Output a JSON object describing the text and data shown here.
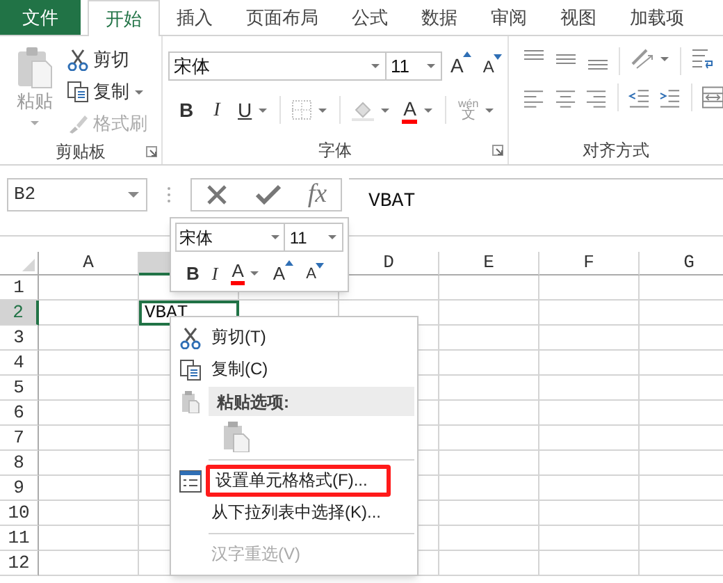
{
  "tabs": [
    {
      "label": "文件",
      "kind": "file",
      "selected": false
    },
    {
      "label": "开始",
      "kind": "tab",
      "selected": true
    },
    {
      "label": "插入",
      "kind": "tab",
      "selected": false
    },
    {
      "label": "页面布局",
      "kind": "tab",
      "selected": false
    },
    {
      "label": "公式",
      "kind": "tab",
      "selected": false
    },
    {
      "label": "数据",
      "kind": "tab",
      "selected": false
    },
    {
      "label": "审阅",
      "kind": "tab",
      "selected": false
    },
    {
      "label": "视图",
      "kind": "tab",
      "selected": false
    },
    {
      "label": "加载项",
      "kind": "tab",
      "selected": false
    }
  ],
  "ribbon": {
    "clipboard": {
      "paste": "粘贴",
      "cut": "剪切",
      "copy": "复制",
      "format_painter": "格式刷",
      "label": "剪贴板"
    },
    "font": {
      "font_name": "宋体",
      "font_size": "11",
      "grow": "A",
      "shrink": "A",
      "bold": "B",
      "italic": "I",
      "underline": "U",
      "font_color": "A",
      "phonetic_top": "wén",
      "phonetic_char": "文",
      "label": "字体"
    },
    "alignment": {
      "label": "对齐方式"
    }
  },
  "formula_bar": {
    "name_box": "B2",
    "function_label": "fx",
    "formula": "VBAT"
  },
  "grid": {
    "columns": [
      {
        "label": "A",
        "selected": false
      },
      {
        "selected": true
      },
      {},
      {
        "label": "D",
        "selected": false
      },
      {
        "label": "E",
        "selected": false
      },
      {
        "label": "F",
        "selected": false
      },
      {
        "label": "G",
        "selected": false
      }
    ],
    "rows": [
      {
        "label": "1",
        "selected": false
      },
      {
        "label": "2",
        "selected": true
      },
      {
        "label": "3",
        "selected": false
      },
      {
        "label": "4",
        "selected": false
      },
      {
        "label": "5",
        "selected": false
      },
      {
        "label": "6",
        "selected": false
      },
      {
        "label": "7",
        "selected": false
      },
      {
        "label": "8",
        "selected": false
      },
      {
        "label": "9",
        "selected": false
      },
      {
        "label": "10",
        "selected": false
      },
      {
        "label": "11",
        "selected": false
      },
      {
        "label": "12",
        "selected": false
      }
    ],
    "active_cell": {
      "value": "VBAT"
    }
  },
  "mini_toolbar": {
    "font_name": "宋体",
    "font_size": "11",
    "bold": "B",
    "italic": "I",
    "font_color": "A",
    "grow": "A",
    "shrink": "A"
  },
  "context_menu": [
    {
      "kind": "item",
      "label": "剪切(T)",
      "disabled": false,
      "highlighted": false
    },
    {
      "kind": "item",
      "label": "复制(C)",
      "disabled": false,
      "highlighted": false
    },
    {
      "kind": "header",
      "label": "粘贴选项:"
    },
    {
      "kind": "paste_options"
    },
    {
      "kind": "separator"
    },
    {
      "kind": "item",
      "label": "设置单元格格式(F)...",
      "disabled": false,
      "highlighted": true
    },
    {
      "kind": "item",
      "label": "从下拉列表中选择(K)...",
      "disabled": false,
      "highlighted": false
    },
    {
      "kind": "separator"
    },
    {
      "kind": "item",
      "label": "汉字重选(V)",
      "disabled": true,
      "highlighted": false
    }
  ]
}
